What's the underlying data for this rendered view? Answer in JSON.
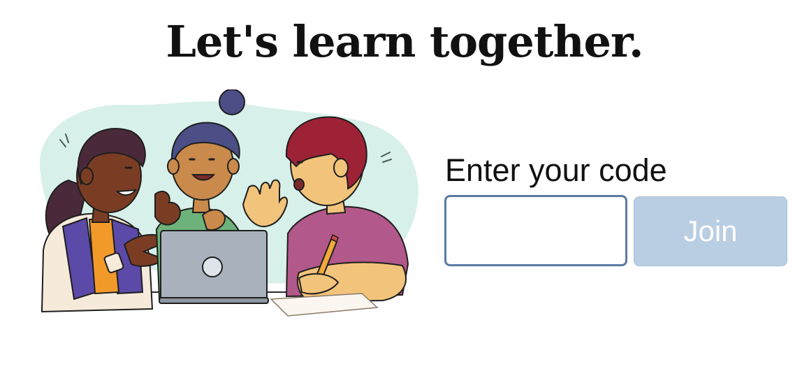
{
  "header": {
    "title": "Let's learn together."
  },
  "illustration": {
    "icon": "students-collaborating-illustration",
    "colors": {
      "backdrop": "#d8f0ea",
      "skin_dark": "#7a3d24",
      "skin_medium": "#c98a4b",
      "skin_light": "#f2c37a",
      "hair_dark": "#4a2a3a",
      "hair_navy": "#4b4f86",
      "hair_red": "#9e2236",
      "vest_purple": "#5b4aa8",
      "shirt_orange": "#f19a2a",
      "shirt_green": "#6db27a",
      "shirt_magenta": "#b3588a",
      "laptop": "#a9b2bc",
      "pencil": "#f1a93a"
    }
  },
  "join": {
    "label": "Enter your code",
    "input_value": "",
    "input_placeholder": "",
    "button_label": "Join",
    "button_enabled": false,
    "colors": {
      "input_border": "#5a7ba6",
      "button_bg": "#b9cde3",
      "button_text": "#ffffff"
    }
  }
}
